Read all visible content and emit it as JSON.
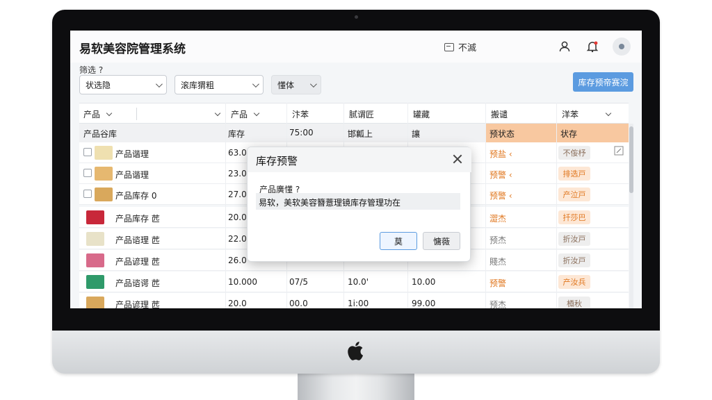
{
  "app": {
    "title": "易软美容院管理系统",
    "top_link": "不滅"
  },
  "filters": {
    "label": "筛选 ?",
    "select1": "状选隐",
    "select2": "滚库猬粗",
    "select3": "懂体",
    "action_button": "库存预帝赛浣"
  },
  "table": {
    "headers": [
      "产品",
      "",
      "产品",
      "汴苯",
      "腻谓匠",
      "罐藏",
      "搬谴",
      "洋苯"
    ],
    "subhead": [
      "产品谷库",
      "库存",
      "75:00",
      "邯瓤上",
      "讓",
      "预状态",
      "状存"
    ],
    "rows": [
      {
        "name": "产品谐理",
        "c1": "63.0",
        "c2": "",
        "c3": "",
        "c4": "",
        "status": "预盐 ‹",
        "tag": "不侫杼",
        "tag_style": "gray",
        "thumb": "#efe0b0"
      },
      {
        "name": "产品谐理",
        "c1": "23.0",
        "c2": "",
        "c3": "",
        "c4": "",
        "status": "预警 ‹",
        "tag": "排选戸",
        "tag_style": "orange",
        "thumb": "#e6b870"
      },
      {
        "name": "产品库存 0",
        "c1": "27.0",
        "c2": "",
        "c3": "",
        "c4": "",
        "status": "预警 ‹",
        "tag": "产泣戸",
        "tag_style": "orange",
        "thumb": "#d9a85c"
      },
      {
        "name": "产品库存 苉",
        "c1": "20.0",
        "c2": "",
        "c3": "",
        "c4": "",
        "status": "澀杰",
        "tag": "扦莎巴",
        "tag_style": "orange",
        "thumb": "#c8283a"
      },
      {
        "name": "产品谘理 苉",
        "c1": "22.0",
        "c2": "",
        "c3": "",
        "c4": "",
        "status": "预杰",
        "tag": "折汝戸",
        "tag_style": "gray",
        "thumb": "#e8e2c8"
      },
      {
        "name": "产品谚理 苉",
        "c1": "26.0",
        "c2": "",
        "c3": "",
        "c4": "",
        "status": "賤杰",
        "tag": "折汝戸",
        "tag_style": "gray",
        "thumb": "#d86a8a"
      },
      {
        "name": "产品谘谔 苉",
        "c1": "10.000",
        "c2": "07/5",
        "c3": "10.0'",
        "c4": "10.00",
        "status": "预警",
        "tag": "产汝兵",
        "tag_style": "orange",
        "thumb": "#2f9a6a"
      },
      {
        "name": "产品谚理 苉",
        "c1": "20.0",
        "c2": "00.0",
        "c3": "1ⅰ:00",
        "c4": "99.00",
        "status": "预杰",
        "tag": "槱秋",
        "tag_style": "gray",
        "thumb": "#d9a85c"
      }
    ]
  },
  "modal": {
    "title": "库存预警",
    "question": "产品廣懂 ?",
    "message": "易软，美软美容簪薏理镜库存管理功在",
    "ok": "莫",
    "cancel": "慵薇"
  },
  "colors": {
    "accent": "#5b9be0",
    "warning": "#e0771f",
    "highlight": "#f8c8a0"
  }
}
